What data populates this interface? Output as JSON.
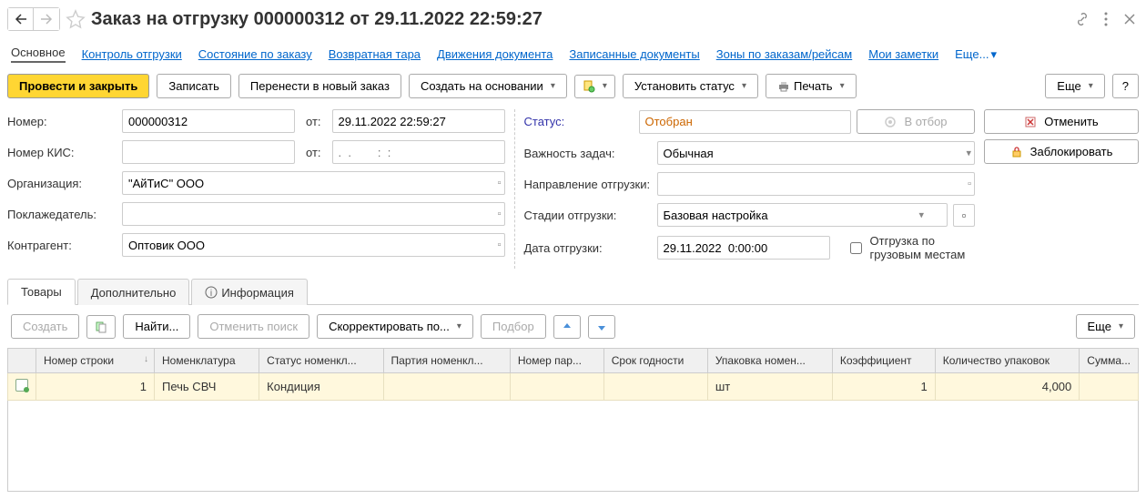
{
  "title": "Заказ на отгрузку 000000312 от 29.11.2022 22:59:27",
  "nav": {
    "main": "Основное",
    "links": [
      "Контроль отгрузки",
      "Состояние по заказу",
      "Возвратная тара",
      "Движения документа",
      "Записанные документы",
      "Зоны по заказам/рейсам",
      "Мои заметки"
    ],
    "more": "Еще..."
  },
  "toolbar": {
    "post_close": "Провести и закрыть",
    "save": "Записать",
    "move_new": "Перенести в новый заказ",
    "create_based": "Создать на основании",
    "set_status": "Установить статус",
    "print": "Печать",
    "more": "Еще",
    "help": "?"
  },
  "form": {
    "number_label": "Номер:",
    "number": "000000312",
    "from": "от:",
    "date": "29.11.2022 22:59:27",
    "kis_label": "Номер КИС:",
    "kis": "",
    "kis_date_placeholder": ".  .        :  :",
    "org_label": "Организация:",
    "org": "\"АйТиС\" ООО",
    "depositor_label": "Поклажедатель:",
    "depositor": "",
    "counterparty_label": "Контрагент:",
    "counterparty": "Оптовик ООО",
    "status_label": "Статус:",
    "status": "Отобран",
    "priority_label": "Важность задач:",
    "priority": "Обычная",
    "direction_label": "Направление отгрузки:",
    "direction": "",
    "stages_label": "Стадии отгрузки:",
    "stages": "Базовая настройка",
    "ship_date_label": "Дата отгрузки:",
    "ship_date": "29.11.2022  0:00:00",
    "by_cargo": "Отгрузка по грузовым местам",
    "to_selection": "В отбор",
    "cancel": "Отменить",
    "lock": "Заблокировать"
  },
  "tabs": {
    "goods": "Товары",
    "extra": "Дополнительно",
    "info": "Информация"
  },
  "subbar": {
    "create": "Создать",
    "find": "Найти...",
    "cancel_search": "Отменить поиск",
    "adjust": "Скорректировать по...",
    "pick": "Подбор",
    "more": "Еще"
  },
  "table": {
    "headers": {
      "row_no": "Номер строки",
      "nomen": "Номенклатура",
      "nomen_status": "Статус номенкл...",
      "batch": "Партия номенкл...",
      "batch_no": "Номер пар...",
      "expiry": "Срок годности",
      "pack": "Упаковка номен...",
      "coef": "Коэффициент",
      "qty": "Количество упаковок",
      "sum": "Сумма..."
    },
    "rows": [
      {
        "row_no": "1",
        "nomen": "Печь СВЧ",
        "nomen_status": "Кондиция",
        "batch": "",
        "batch_no": "",
        "expiry": "",
        "pack": "шт",
        "coef": "1",
        "qty": "4,000",
        "sum": ""
      }
    ]
  }
}
